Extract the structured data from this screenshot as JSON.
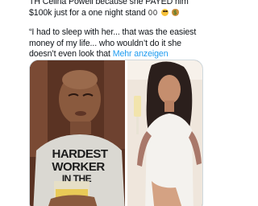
{
  "tweet": {
    "header_line": "TH  Celina Powell because she PAYED him $100k just for a one night stand",
    "quote_line": "“I had to sleep with her... that was the easiest money of my life... who wouldn’t do it she doesn’t even look that",
    "more_link": "Mehr anzeigen",
    "emojis": [
      "eyes-icon",
      "flushed-face-icon",
      "money-bag-icon"
    ]
  },
  "media": {
    "left_image": {
      "shirt_text_line1": "HARDEST",
      "shirt_text_line2": "WORKER",
      "shirt_text_line3": "IN THE"
    },
    "right_image": {}
  }
}
